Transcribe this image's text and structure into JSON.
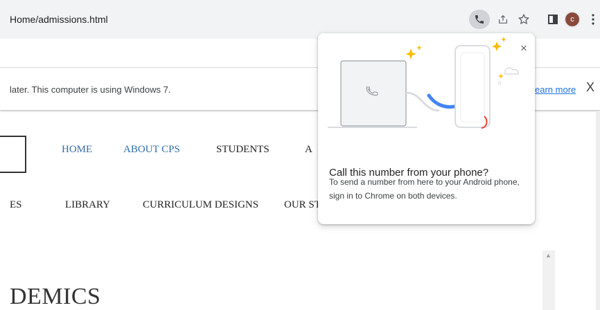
{
  "toolbar": {
    "url": "Home/admissions.html",
    "avatar_letter": "c",
    "icons": {
      "phone": "phone-icon",
      "share": "share-icon",
      "star": "star-icon",
      "side_panel": "side-panel-icon",
      "menu": "kebab-menu-icon"
    },
    "avatar_color": "#8a4a3b"
  },
  "infobar": {
    "message": "later. This computer is using Windows 7.",
    "learn_more": "earn more",
    "close": "X"
  },
  "page": {
    "nav_row1": [
      "HOME",
      "ABOUT CPS",
      "STUDENTS",
      "A"
    ],
    "nav_row2": [
      "ES",
      "LIBRARY",
      "CURRICULUM DESIGNS",
      "OUR ST."
    ],
    "heading": "DEMICS",
    "link_color": "#2f6dad"
  },
  "bubble": {
    "title": "Call this number from your phone?",
    "body": "To send a number from here to your Android phone, sign in to Chrome on both devices.",
    "close": "×",
    "accent": "#4285f4"
  }
}
